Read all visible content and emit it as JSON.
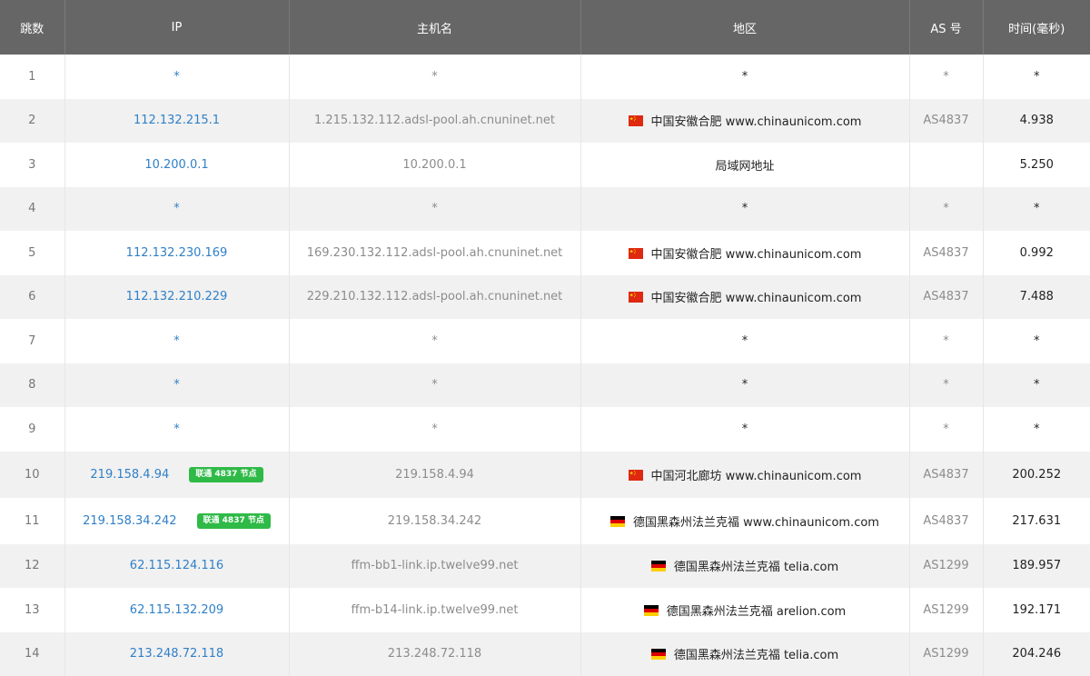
{
  "columns": [
    "跳数",
    "IP",
    "主机名",
    "地区",
    "AS 号",
    "时间(毫秒)"
  ],
  "colors": {
    "header_bg": "#666666",
    "ip_link": "#2f80c8",
    "badge": "#2fba47",
    "row_alt": "#f1f1f1"
  },
  "rows": [
    {
      "hop": "1",
      "ip": "*",
      "host": "*",
      "flag": "",
      "geo": "*",
      "asn": "*",
      "time": "*"
    },
    {
      "hop": "2",
      "ip": "112.132.215.1",
      "host": "1.215.132.112.adsl-pool.ah.cnuninet.net",
      "flag": "cn-flag-icon",
      "geo": "中国安徽合肥 www.chinaunicom.com",
      "asn": "AS4837",
      "time": "4.938"
    },
    {
      "hop": "3",
      "ip": "10.200.0.1",
      "host": "10.200.0.1",
      "flag": "",
      "geo": "局域网地址",
      "asn": "",
      "time": "5.250"
    },
    {
      "hop": "4",
      "ip": "*",
      "host": "*",
      "flag": "",
      "geo": "*",
      "asn": "*",
      "time": "*"
    },
    {
      "hop": "5",
      "ip": "112.132.230.169",
      "host": "169.230.132.112.adsl-pool.ah.cnuninet.net",
      "flag": "cn-flag-icon",
      "geo": "中国安徽合肥 www.chinaunicom.com",
      "asn": "AS4837",
      "time": "0.992"
    },
    {
      "hop": "6",
      "ip": "112.132.210.229",
      "host": "229.210.132.112.adsl-pool.ah.cnuninet.net",
      "flag": "cn-flag-icon",
      "geo": "中国安徽合肥 www.chinaunicom.com",
      "asn": "AS4837",
      "time": "7.488"
    },
    {
      "hop": "7",
      "ip": "*",
      "host": "*",
      "flag": "",
      "geo": "*",
      "asn": "*",
      "time": "*"
    },
    {
      "hop": "8",
      "ip": "*",
      "host": "*",
      "flag": "",
      "geo": "*",
      "asn": "*",
      "time": "*"
    },
    {
      "hop": "9",
      "ip": "*",
      "host": "*",
      "flag": "",
      "geo": "*",
      "asn": "*",
      "time": "*"
    },
    {
      "hop": "10",
      "ip": "219.158.4.94",
      "badge": "联通 4837 节点",
      "host": "219.158.4.94",
      "flag": "cn-flag-icon",
      "geo": "中国河北廊坊 www.chinaunicom.com",
      "asn": "AS4837",
      "time": "200.252"
    },
    {
      "hop": "11",
      "ip": "219.158.34.242",
      "badge": "联通 4837 节点",
      "host": "219.158.34.242",
      "flag": "de-flag-icon",
      "geo": "德国黑森州法兰克福 www.chinaunicom.com",
      "asn": "AS4837",
      "time": "217.631"
    },
    {
      "hop": "12",
      "ip": "62.115.124.116",
      "host": "ffm-bb1-link.ip.twelve99.net",
      "flag": "de-flag-icon",
      "geo": "德国黑森州法兰克福 telia.com",
      "asn": "AS1299",
      "time": "189.957"
    },
    {
      "hop": "13",
      "ip": "62.115.132.209",
      "host": "ffm-b14-link.ip.twelve99.net",
      "flag": "de-flag-icon",
      "geo": "德国黑森州法兰克福 arelion.com",
      "asn": "AS1299",
      "time": "192.171"
    },
    {
      "hop": "14",
      "ip": "213.248.72.118",
      "host": "213.248.72.118",
      "flag": "de-flag-icon",
      "geo": "德国黑森州法兰克福 telia.com",
      "asn": "AS1299",
      "time": "204.246"
    }
  ]
}
